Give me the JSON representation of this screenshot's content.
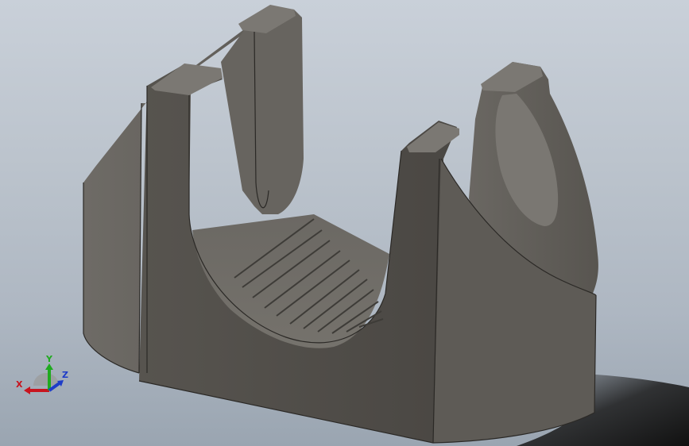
{
  "viewport": {
    "background_top": "#c9d0d9",
    "background_bottom": "#9aa5b1",
    "model_color": "#5a5753",
    "shadow_color": "#1c1c1c"
  },
  "triad": {
    "x_label": "X",
    "y_label": "Y",
    "z_label": "Z",
    "x_color": "#c8141e",
    "y_color": "#1faa1f",
    "z_color": "#1e3cc8"
  }
}
